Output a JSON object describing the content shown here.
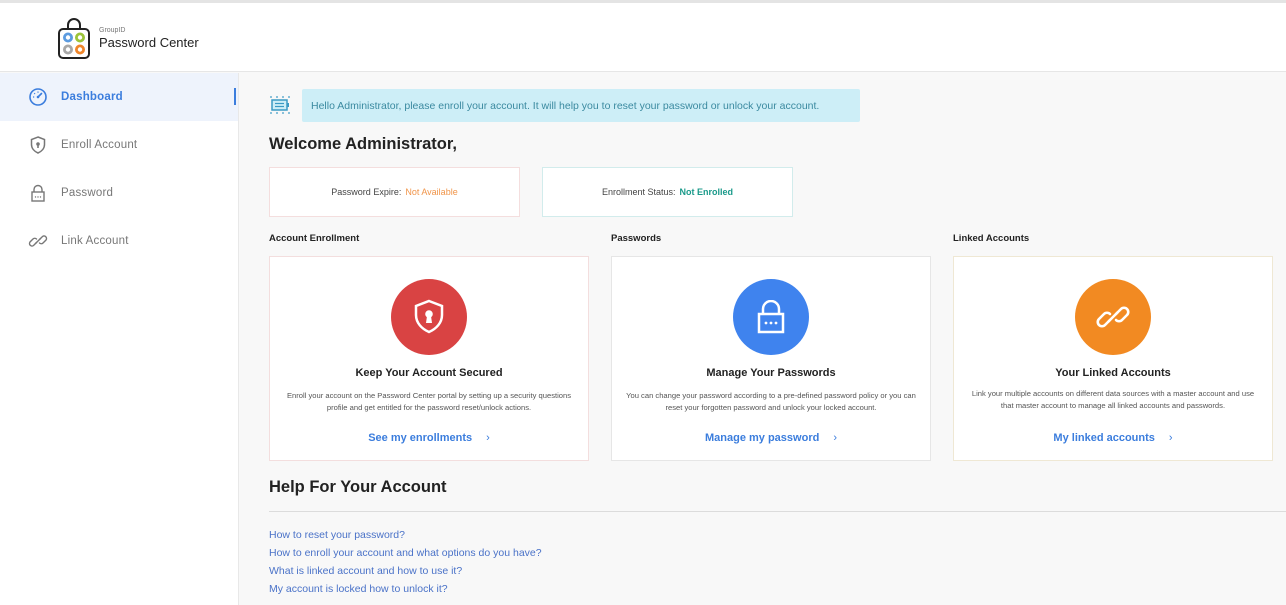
{
  "header": {
    "brand_small": "GroupID",
    "brand_name": "Password Center"
  },
  "sidebar": {
    "items": [
      {
        "label": "Dashboard",
        "icon": "dashboard-icon",
        "active": true
      },
      {
        "label": "Enroll Account",
        "icon": "shield-icon",
        "active": false
      },
      {
        "label": "Password",
        "icon": "lock-icon",
        "active": false
      },
      {
        "label": "Link Account",
        "icon": "link-icon",
        "active": false
      }
    ]
  },
  "main": {
    "banner_text": "Hello Administrator, please enroll your account. It will help you to reset your password or unlock your account.",
    "welcome": "Welcome Administrator,",
    "stats": {
      "expire_label": "Password Expire:",
      "expire_value": "Not Available",
      "enroll_label": "Enrollment Status:",
      "enroll_value": "Not Enrolled"
    },
    "sections": [
      {
        "label": "Account Enrollment",
        "title": "Keep Your Account Secured",
        "desc": "Enroll your account on the Password Center portal by setting up a security questions profile and get entitled for the password reset/unlock actions.",
        "link": "See my enrollments",
        "color": "#d94343"
      },
      {
        "label": "Passwords",
        "title": "Manage Your Passwords",
        "desc": "You can change your password according to a pre-defined password policy or you can reset your forgotten password and unlock your locked account.",
        "link": "Manage my password",
        "color": "#3f83ee"
      },
      {
        "label": "Linked Accounts",
        "title": "Your Linked Accounts",
        "desc": "Link your multiple accounts on different data sources with a master account and use that master account to manage all linked accounts and passwords.",
        "link": "My linked accounts",
        "color": "#f28a22"
      }
    ],
    "chevron": "›",
    "help": {
      "title": "Help For Your Account",
      "links": [
        "How to reset your password?",
        "How to enroll your account and what options do you have?",
        "What is linked account and how to use it?",
        "My account is locked how to unlock it?"
      ]
    }
  }
}
